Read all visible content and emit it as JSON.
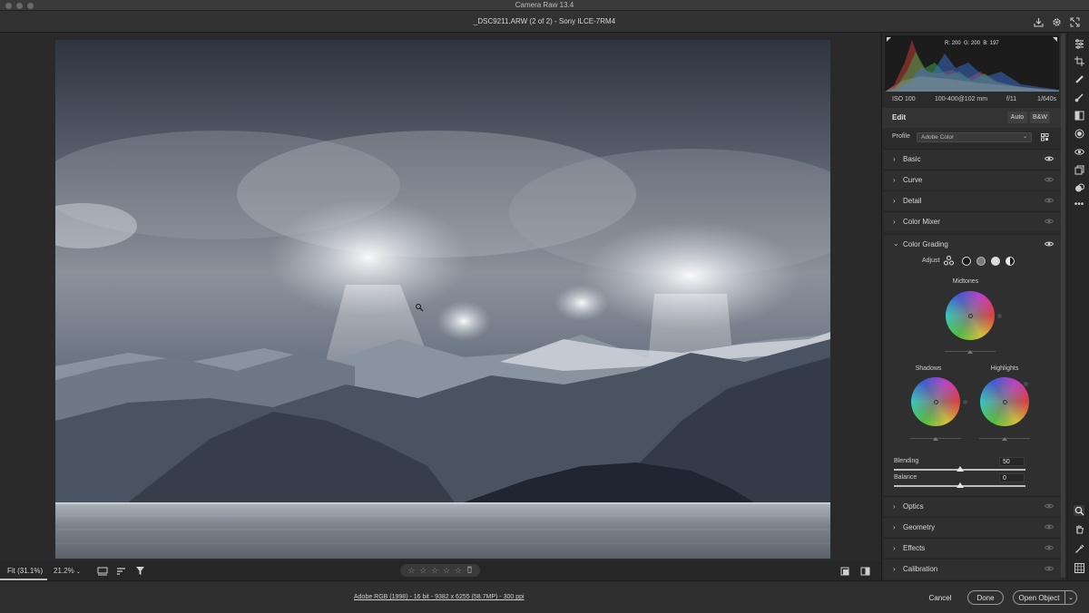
{
  "window": {
    "title": "Camera Raw 13.4"
  },
  "header": {
    "file_label": "_DSC9211.ARW (2 of 2)  -  Sony ILCE-7RM4",
    "icons": [
      "save-icon",
      "settings-gear-icon",
      "fullscreen-icon"
    ]
  },
  "canvas": {
    "zoom_fit_label": "Fit (31.1%)",
    "zoom_percent": "21.2%",
    "rating_stars": [
      "☆",
      "☆",
      "☆",
      "☆",
      "☆"
    ],
    "rating_trash": "🗑"
  },
  "histogram": {
    "readout_r": "R: 200",
    "readout_g": "G: 200",
    "readout_b": "B: 197"
  },
  "exif": {
    "iso": "ISO 100",
    "lens": "100-400@102 mm",
    "aperture": "f/11",
    "shutter": "1/640s"
  },
  "edit": {
    "title": "Edit",
    "auto_label": "Auto",
    "bw_label": "B&W",
    "profile_label": "Profile",
    "profile_value": "Adobe Color"
  },
  "sections_top": [
    {
      "name": "Basic",
      "chevron": "›",
      "visible": true
    },
    {
      "name": "Curve",
      "chevron": "›",
      "visible": false
    },
    {
      "name": "Detail",
      "chevron": "›",
      "visible": false
    },
    {
      "name": "Color Mixer",
      "chevron": "›",
      "visible": false
    }
  ],
  "color_grading": {
    "name": "Color Grading",
    "chevron": "⌄",
    "adjust_label": "Adjust",
    "midtones_label": "Midtones",
    "shadows_label": "Shadows",
    "highlights_label": "Highlights",
    "blending_label": "Blending",
    "blending_value": "50",
    "balance_label": "Balance",
    "balance_value": "0"
  },
  "sections_bottom": [
    {
      "name": "Optics",
      "chevron": "›"
    },
    {
      "name": "Geometry",
      "chevron": "›"
    },
    {
      "name": "Effects",
      "chevron": "›"
    },
    {
      "name": "Calibration",
      "chevron": "›"
    }
  ],
  "footer": {
    "image_info": "Adobe RGB (1998) - 16 bit - 9382 x 6255 (58.7MP) - 300 ppi",
    "cancel_label": "Cancel",
    "done_label": "Done",
    "open_object_label": "Open Object"
  },
  "colors": {
    "panel_bg": "#2b2b2b",
    "canvas_bg": "#2a2a2a",
    "accent": "#e6e6e6"
  }
}
